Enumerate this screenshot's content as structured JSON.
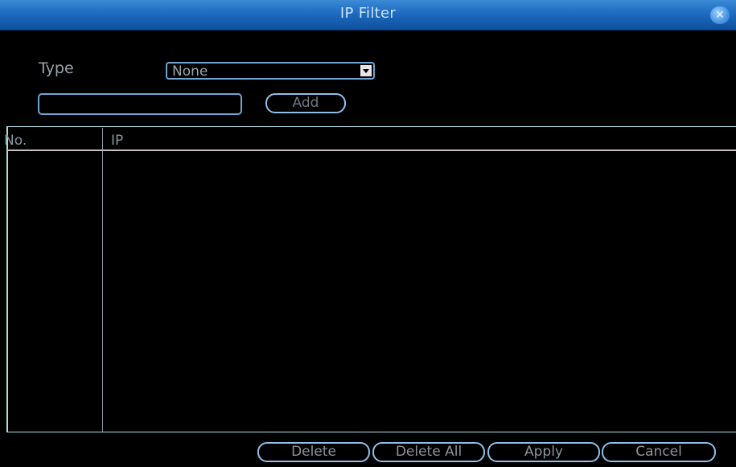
{
  "window": {
    "title": "IP Filter",
    "close_icon": "close-icon"
  },
  "filter": {
    "type_label": "Type",
    "type_value": "None",
    "ip_input_value": "",
    "add_label": "Add"
  },
  "table": {
    "columns": [
      "No.",
      "IP"
    ],
    "rows": []
  },
  "footer": {
    "delete_label": "Delete",
    "delete_all_label": "Delete All",
    "apply_label": "Apply",
    "cancel_label": "Cancel"
  },
  "colors": {
    "title_bar": "#1e6bc0",
    "accent_border": "#6fa6d6",
    "table_border": "#a9dfe8",
    "background": "#000000"
  }
}
